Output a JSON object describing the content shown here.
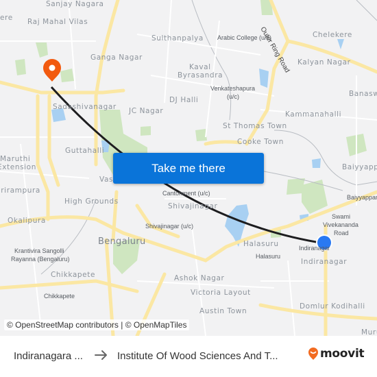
{
  "map": {
    "labels": {
      "sanjay_nagara": "Sanjay Nagara",
      "raj_mahal_vilas": "Raj Mahal Vilas",
      "ere": "ere",
      "ganga_nagar": "Ganga Nagar",
      "sulthanpalya": "Sulthanpalya",
      "arabic_college": "Arabic College (u/c)",
      "outer_ring_road": "Outer Ring Road",
      "chelekere": "Chelekere",
      "kaval": "Kaval",
      "byrasandra": "Byrasandra",
      "kalyan_nagar": "Kalyan Nagar",
      "venkateshapura_1": "Venkateshapura",
      "venkateshapura_2": "(u/c)",
      "banaswadi": "Banasw",
      "dj_halli": "DJ Halli",
      "sadashivanagar": "Sadashivanagar",
      "jc_nagar": "JC Nagar",
      "kammanahalli": "Kammanahalli",
      "st_thomas_town": "St Thomas Town",
      "cooke_town": "Cooke Town",
      "guttahalli": "Guttahalli",
      "maruthi": "Maruthi",
      "extension": "Extension",
      "baiyyappanahalli": "Baiyyappa",
      "srirampura": "Srirampura",
      "vasanth": "Vasa",
      "cantonment": "Cantonment (u/c)",
      "baiyyappanahalli_station": "Baiyyappan",
      "high_grounds": "High Grounds",
      "shivajinagar": "Shivajinagar",
      "okalipura": "Okalipura",
      "swami_1": "Swami",
      "swami_2": "Vivekananda",
      "swami_3": "Road",
      "shivajinagar_station": "Shivajinagar (u/c)",
      "bengaluru": "Bengaluru",
      "halasuru": "Halasuru",
      "halasuru_station": "Halasuru",
      "indiranagar_station": "Indiranagar",
      "indiranagar": "Indiranagar",
      "krantivira_1": "Krantivira Sangolli",
      "krantivira_2": "Rayanna (Bengaluru)",
      "chikkapete": "Chikkapete",
      "chikkapete_station": "Chikkapete",
      "ashok_nagar": "Ashok Nagar",
      "victoria_layout": "Victoria Layout",
      "austin_town": "Austin Town",
      "domlur_kodihalli": "Domlur Kodihalli",
      "murugeshpalya": "Muru"
    },
    "route_color": "#1d1d1f",
    "destination_pin_color": "#f25a0f",
    "origin_dot_color": "#2979f2",
    "attribution": "© OpenStreetMap contributors | © OpenMapTiles"
  },
  "cta": {
    "label": "Take me there",
    "color": "#0a74d9"
  },
  "footer": {
    "origin": "Indiranagara ...",
    "destination": "Institute Of Wood Sciences And T...",
    "brand": "moovit",
    "brand_color": "#f26b21"
  }
}
